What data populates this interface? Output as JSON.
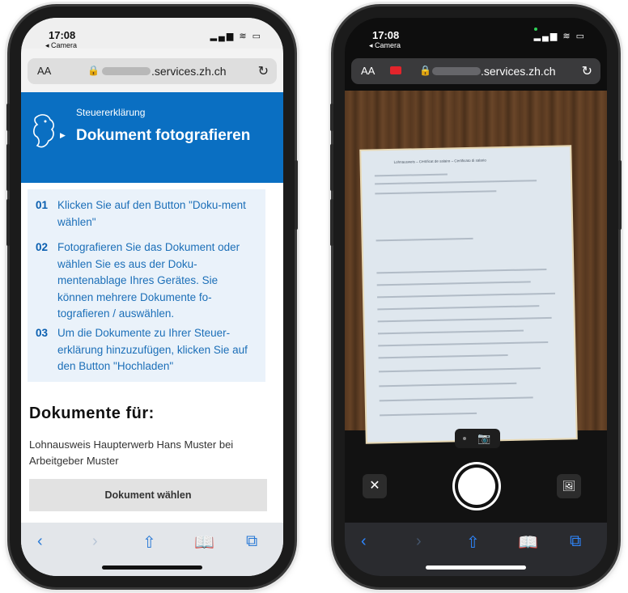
{
  "left_phone": {
    "status": {
      "time": "17:08",
      "back_app": "◂ Camera",
      "icons": "▂▄▆ ≋ ▭"
    },
    "urlbar": {
      "aa": "AA",
      "lock": "🔒",
      "host": ".services.zh.ch",
      "reload": "↻"
    },
    "header": {
      "kicker": "Steuererklärung",
      "title": "Dokument fotografieren"
    },
    "steps": [
      {
        "num": "01",
        "text": "Klicken Sie auf den Button \"Doku-ment wählen\""
      },
      {
        "num": "02",
        "text": "Fotografieren Sie das Dokument oder wählen Sie es aus der Doku-mentenablage Ihres Gerätes. Sie können mehrere Dokumente fo-tografieren / auswählen."
      },
      {
        "num": "03",
        "text": "Um die Dokumente zu Ihrer Steuer-erklärung hinzuzufügen, klicken Sie auf den Button \"Hochladen\""
      }
    ],
    "docs_title": "Dokumente für:",
    "docs_text": "Lohnausweis Haupterwerb Hans Muster bei Arbeitgeber Muster",
    "choose_button": "Dokument wählen",
    "toolbar": {
      "back": "‹",
      "forward": "›",
      "share": "⇧",
      "bookmarks": "📖",
      "tabs": "⧉"
    }
  },
  "right_phone": {
    "status": {
      "time": "17:08",
      "back_app": "◂ Camera",
      "icons": "▂▄▆ ≋ ▭"
    },
    "urlbar": {
      "aa": "AA",
      "lock": "🔒",
      "host": ".services.zh.ch",
      "reload": "↻"
    },
    "camera": {
      "photo_icon": "📷",
      "close": "✕",
      "gallery": "🖼"
    },
    "paper_header": "Lohnausweis – Certificat de salaire – Certificato di salario",
    "toolbar": {
      "back": "‹",
      "forward": "›",
      "share": "⇧",
      "bookmarks": "📖",
      "tabs": "⧉"
    }
  },
  "colors": {
    "brand_blue": "#0a6fc2",
    "step_bg": "#eaf2fa",
    "link_blue": "#1c6fb8"
  }
}
